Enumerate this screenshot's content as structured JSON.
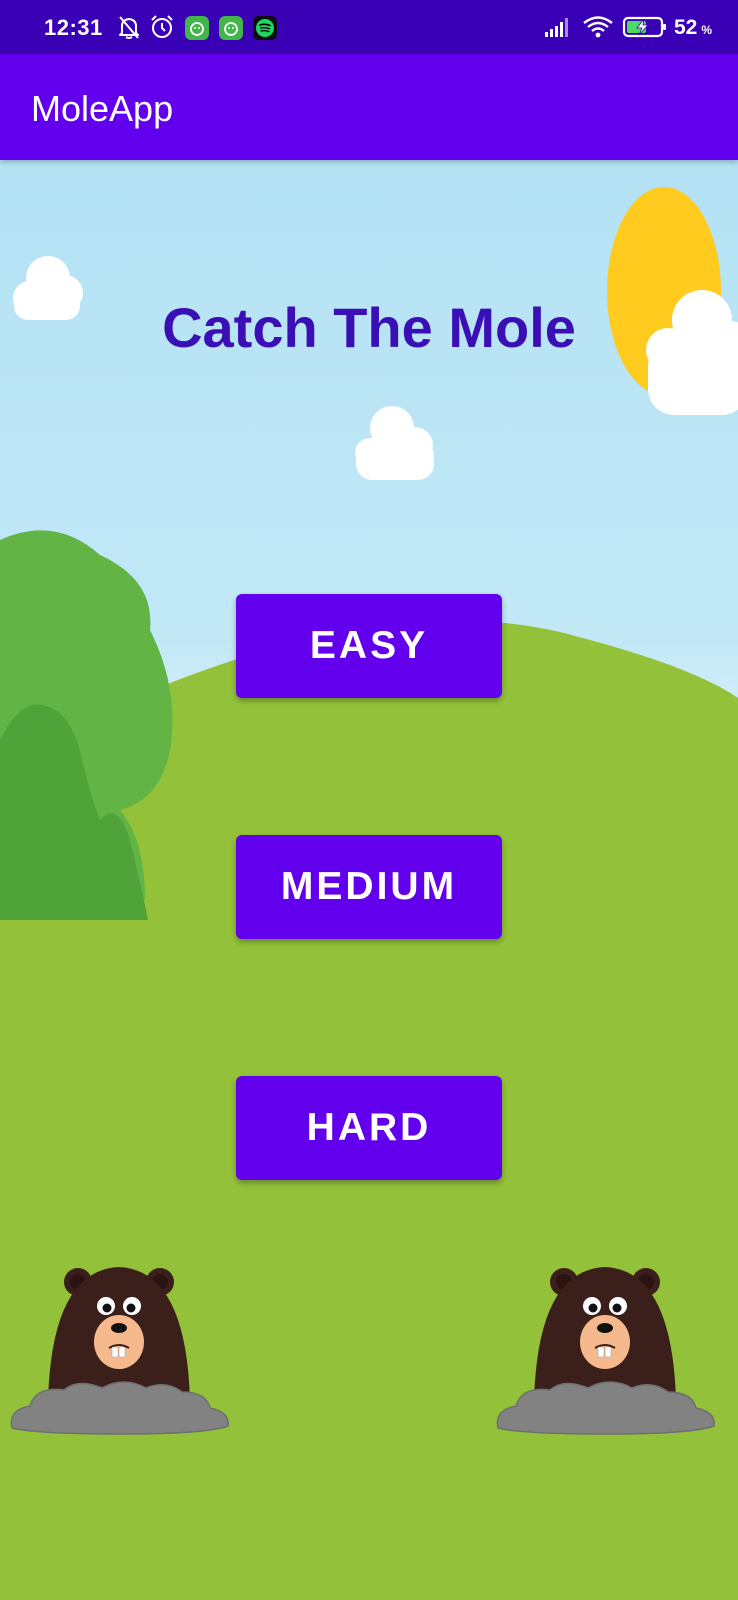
{
  "status_bar": {
    "time": "12:31",
    "battery_percent": "52",
    "battery_unit": "%",
    "icons": [
      "bell-off-icon",
      "alarm-icon",
      "app-notification-icon",
      "app-notification-icon",
      "spotify-icon",
      "signal-icon",
      "wifi-icon",
      "battery-charging-icon"
    ]
  },
  "app_bar": {
    "title": "MoleApp"
  },
  "main": {
    "game_title": "Catch The Mole",
    "buttons": {
      "easy": "EASY",
      "medium": "MEDIUM",
      "hard": "HARD"
    }
  },
  "colors": {
    "status_bar": "#3a00b5",
    "app_bar": "#6200ee",
    "button": "#6200ee",
    "title_text": "#3a0fb5",
    "sky": "#bfe6f6",
    "grass": "#93c23a",
    "sun": "#ffcb1f",
    "mole_fur": "#3b1f1a",
    "rock": "#828282"
  }
}
